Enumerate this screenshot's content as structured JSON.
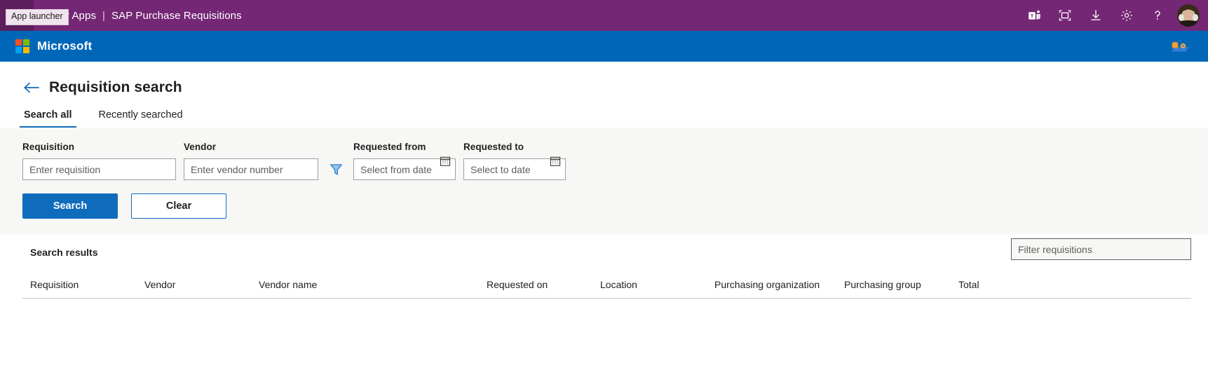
{
  "suite": {
    "waffle_name": "app-launcher",
    "tooltip": "App launcher",
    "brand": "Power Apps",
    "separator": "|",
    "app_name": "SAP Purchase Requisitions",
    "icons": [
      {
        "name": "teams-icon",
        "label": "Microsoft Teams"
      },
      {
        "name": "capture-icon",
        "label": "Screen capture"
      },
      {
        "name": "download-icon",
        "label": "Download"
      },
      {
        "name": "gear-icon",
        "label": "Settings"
      },
      {
        "name": "help-icon",
        "label": "Help"
      }
    ],
    "avatar_label": "Account manager"
  },
  "brandbar": {
    "logo_name": "microsoft-logo",
    "wordmark": "Microsoft",
    "data_icon_name": "data-settings-icon"
  },
  "header": {
    "back_label": "Back",
    "title": "Requisition search"
  },
  "tabs": [
    {
      "label": "Search all",
      "active": true
    },
    {
      "label": "Recently searched",
      "active": false
    }
  ],
  "search_form": {
    "requisition": {
      "label": "Requisition",
      "placeholder": "Enter requisition",
      "value": ""
    },
    "vendor": {
      "label": "Vendor",
      "placeholder": "Enter vendor number",
      "value": ""
    },
    "filter_icon": "funnel-icon",
    "requested_from": {
      "label": "Requested from",
      "placeholder": "Select from date",
      "value": "",
      "icon": "calendar-icon"
    },
    "requested_to": {
      "label": "Requested to",
      "placeholder": "Select to date",
      "value": "",
      "icon": "calendar-icon"
    },
    "search_button": "Search",
    "clear_button": "Clear"
  },
  "results": {
    "title": "Search results",
    "filter": {
      "placeholder": "Filter requisitions",
      "value": ""
    },
    "columns": [
      "Requisition",
      "Vendor",
      "Vendor name",
      "Requested on",
      "Location",
      "Purchasing organization",
      "Purchasing group",
      "Total"
    ],
    "rows": []
  },
  "colors": {
    "suite_bar": "#742774",
    "brand_bar": "#0067b8",
    "accent": "#0f6cbd",
    "panel_bg": "#f7f7f5"
  }
}
